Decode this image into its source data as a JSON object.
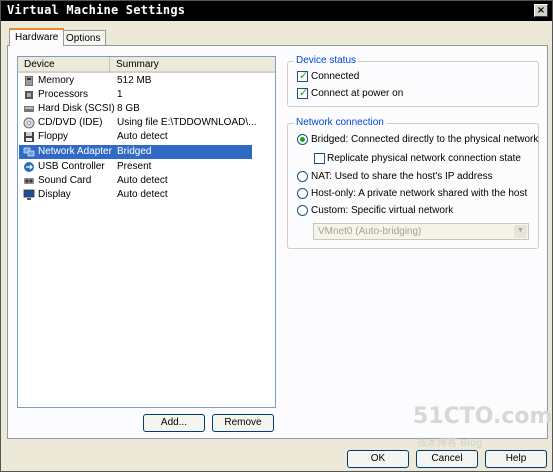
{
  "window": {
    "title": "Virtual Machine Settings",
    "close_glyph": "×"
  },
  "tabs": [
    {
      "label": "Hardware",
      "active": true
    },
    {
      "label": "Options",
      "active": false
    }
  ],
  "device_list": {
    "columns": [
      "Device",
      "Summary"
    ],
    "rows": [
      {
        "name": "Memory",
        "summary": "512 MB",
        "icon": "memory-icon"
      },
      {
        "name": "Processors",
        "summary": "1",
        "icon": "processor-icon"
      },
      {
        "name": "Hard Disk (SCSI)",
        "summary": "8 GB",
        "icon": "harddisk-icon"
      },
      {
        "name": "CD/DVD (IDE)",
        "summary": "Using file E:\\TDDOWNLOAD\\...",
        "icon": "cd-icon"
      },
      {
        "name": "Floppy",
        "summary": "Auto detect",
        "icon": "floppy-icon"
      },
      {
        "name": "Network Adapter",
        "summary": "Bridged",
        "icon": "network-icon",
        "selected": true
      },
      {
        "name": "USB Controller",
        "summary": "Present",
        "icon": "usb-icon"
      },
      {
        "name": "Sound Card",
        "summary": "Auto detect",
        "icon": "sound-icon"
      },
      {
        "name": "Display",
        "summary": "Auto detect",
        "icon": "display-icon"
      }
    ]
  },
  "buttons": {
    "add": "Add...",
    "remove": "Remove",
    "ok": "OK",
    "cancel": "Cancel",
    "help": "Help"
  },
  "device_status": {
    "legend": "Device status",
    "connected": {
      "label": "Connected",
      "checked": true
    },
    "connect_power_on": {
      "label": "Connect at power on",
      "checked": true
    }
  },
  "network_connection": {
    "legend": "Network connection",
    "bridged": {
      "label": "Bridged: Connected directly to the physical network",
      "selected": true
    },
    "replicate": {
      "label": "Replicate physical network connection state",
      "checked": false
    },
    "nat": {
      "label": "NAT: Used to share the host's IP address",
      "selected": false
    },
    "host_only": {
      "label": "Host-only: A private network shared with the host",
      "selected": false
    },
    "custom": {
      "label": "Custom: Specific virtual network",
      "selected": false
    },
    "vmnet_select": {
      "value": "VMnet0 (Auto-bridging)",
      "disabled": true
    }
  },
  "watermark": {
    "logo": "51CTO.com",
    "sub": "技术博客  Blog"
  },
  "colors": {
    "accent": "#316ac5",
    "title_bg": "#000000",
    "legend": "#0046d5",
    "check": "#21a121"
  }
}
